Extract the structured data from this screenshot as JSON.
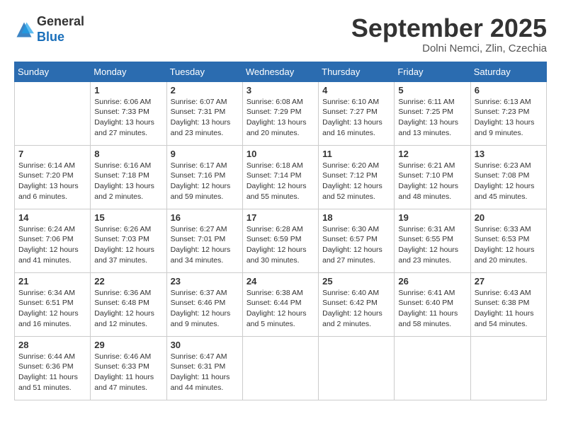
{
  "logo": {
    "general": "General",
    "blue": "Blue"
  },
  "header": {
    "month": "September 2025",
    "location": "Dolni Nemci, Zlin, Czechia"
  },
  "weekdays": [
    "Sunday",
    "Monday",
    "Tuesday",
    "Wednesday",
    "Thursday",
    "Friday",
    "Saturday"
  ],
  "weeks": [
    [
      {
        "day": "",
        "info": ""
      },
      {
        "day": "1",
        "info": "Sunrise: 6:06 AM\nSunset: 7:33 PM\nDaylight: 13 hours and 27 minutes."
      },
      {
        "day": "2",
        "info": "Sunrise: 6:07 AM\nSunset: 7:31 PM\nDaylight: 13 hours and 23 minutes."
      },
      {
        "day": "3",
        "info": "Sunrise: 6:08 AM\nSunset: 7:29 PM\nDaylight: 13 hours and 20 minutes."
      },
      {
        "day": "4",
        "info": "Sunrise: 6:10 AM\nSunset: 7:27 PM\nDaylight: 13 hours and 16 minutes."
      },
      {
        "day": "5",
        "info": "Sunrise: 6:11 AM\nSunset: 7:25 PM\nDaylight: 13 hours and 13 minutes."
      },
      {
        "day": "6",
        "info": "Sunrise: 6:13 AM\nSunset: 7:23 PM\nDaylight: 13 hours and 9 minutes."
      }
    ],
    [
      {
        "day": "7",
        "info": "Sunrise: 6:14 AM\nSunset: 7:20 PM\nDaylight: 13 hours and 6 minutes."
      },
      {
        "day": "8",
        "info": "Sunrise: 6:16 AM\nSunset: 7:18 PM\nDaylight: 13 hours and 2 minutes."
      },
      {
        "day": "9",
        "info": "Sunrise: 6:17 AM\nSunset: 7:16 PM\nDaylight: 12 hours and 59 minutes."
      },
      {
        "day": "10",
        "info": "Sunrise: 6:18 AM\nSunset: 7:14 PM\nDaylight: 12 hours and 55 minutes."
      },
      {
        "day": "11",
        "info": "Sunrise: 6:20 AM\nSunset: 7:12 PM\nDaylight: 12 hours and 52 minutes."
      },
      {
        "day": "12",
        "info": "Sunrise: 6:21 AM\nSunset: 7:10 PM\nDaylight: 12 hours and 48 minutes."
      },
      {
        "day": "13",
        "info": "Sunrise: 6:23 AM\nSunset: 7:08 PM\nDaylight: 12 hours and 45 minutes."
      }
    ],
    [
      {
        "day": "14",
        "info": "Sunrise: 6:24 AM\nSunset: 7:06 PM\nDaylight: 12 hours and 41 minutes."
      },
      {
        "day": "15",
        "info": "Sunrise: 6:26 AM\nSunset: 7:03 PM\nDaylight: 12 hours and 37 minutes."
      },
      {
        "day": "16",
        "info": "Sunrise: 6:27 AM\nSunset: 7:01 PM\nDaylight: 12 hours and 34 minutes."
      },
      {
        "day": "17",
        "info": "Sunrise: 6:28 AM\nSunset: 6:59 PM\nDaylight: 12 hours and 30 minutes."
      },
      {
        "day": "18",
        "info": "Sunrise: 6:30 AM\nSunset: 6:57 PM\nDaylight: 12 hours and 27 minutes."
      },
      {
        "day": "19",
        "info": "Sunrise: 6:31 AM\nSunset: 6:55 PM\nDaylight: 12 hours and 23 minutes."
      },
      {
        "day": "20",
        "info": "Sunrise: 6:33 AM\nSunset: 6:53 PM\nDaylight: 12 hours and 20 minutes."
      }
    ],
    [
      {
        "day": "21",
        "info": "Sunrise: 6:34 AM\nSunset: 6:51 PM\nDaylight: 12 hours and 16 minutes."
      },
      {
        "day": "22",
        "info": "Sunrise: 6:36 AM\nSunset: 6:48 PM\nDaylight: 12 hours and 12 minutes."
      },
      {
        "day": "23",
        "info": "Sunrise: 6:37 AM\nSunset: 6:46 PM\nDaylight: 12 hours and 9 minutes."
      },
      {
        "day": "24",
        "info": "Sunrise: 6:38 AM\nSunset: 6:44 PM\nDaylight: 12 hours and 5 minutes."
      },
      {
        "day": "25",
        "info": "Sunrise: 6:40 AM\nSunset: 6:42 PM\nDaylight: 12 hours and 2 minutes."
      },
      {
        "day": "26",
        "info": "Sunrise: 6:41 AM\nSunset: 6:40 PM\nDaylight: 11 hours and 58 minutes."
      },
      {
        "day": "27",
        "info": "Sunrise: 6:43 AM\nSunset: 6:38 PM\nDaylight: 11 hours and 54 minutes."
      }
    ],
    [
      {
        "day": "28",
        "info": "Sunrise: 6:44 AM\nSunset: 6:36 PM\nDaylight: 11 hours and 51 minutes."
      },
      {
        "day": "29",
        "info": "Sunrise: 6:46 AM\nSunset: 6:33 PM\nDaylight: 11 hours and 47 minutes."
      },
      {
        "day": "30",
        "info": "Sunrise: 6:47 AM\nSunset: 6:31 PM\nDaylight: 11 hours and 44 minutes."
      },
      {
        "day": "",
        "info": ""
      },
      {
        "day": "",
        "info": ""
      },
      {
        "day": "",
        "info": ""
      },
      {
        "day": "",
        "info": ""
      }
    ]
  ]
}
